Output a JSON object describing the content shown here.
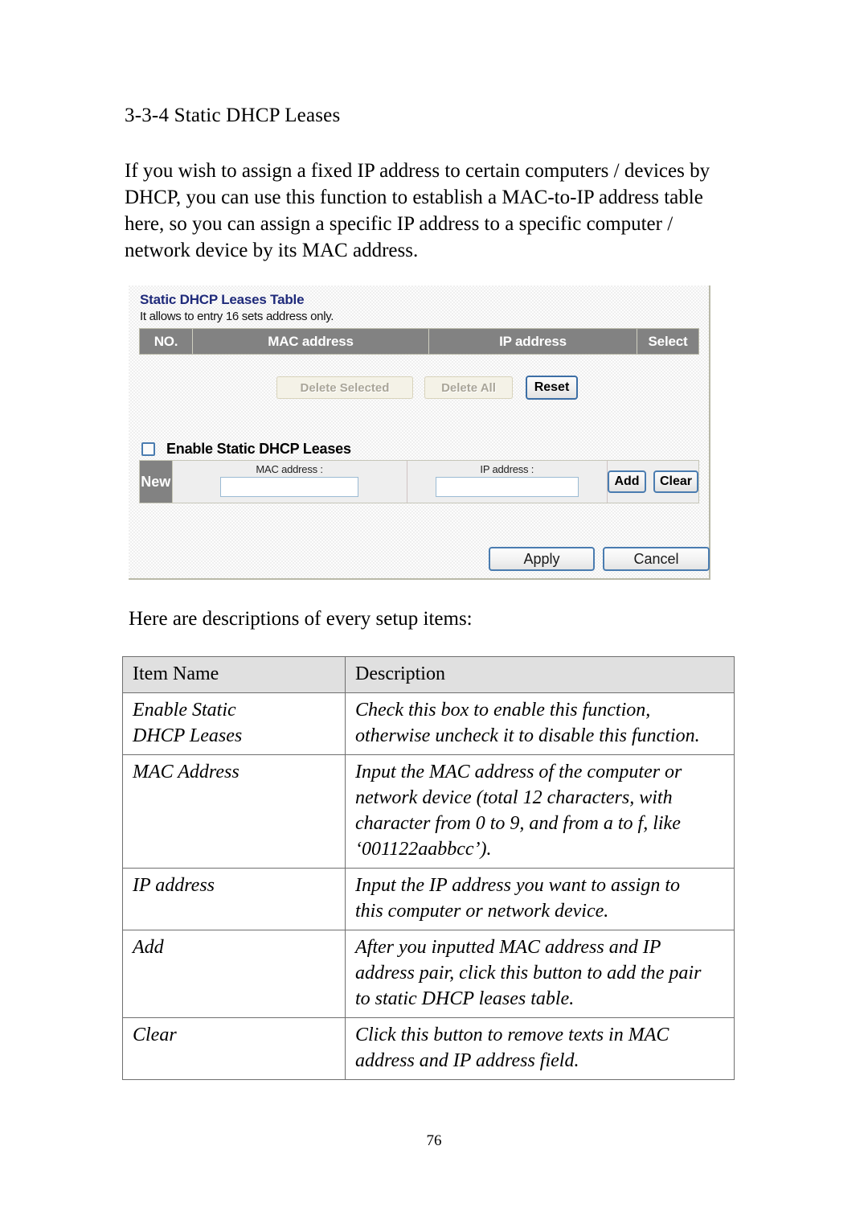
{
  "document": {
    "heading": "3-3-4 Static DHCP Leases",
    "intro_paragraph": "If you wish to assign a fixed IP address to certain computers / devices by DHCP, you can use this function to establish a MAC-to-IP address table here, so you can assign a specific IP address to a specific computer / network device by its MAC address.",
    "mid_paragraph": "Here are descriptions of every setup items:",
    "page_number": "76"
  },
  "screenshot": {
    "title": "Static DHCP Leases Table",
    "subtitle": "It allows to entry 16 sets address only.",
    "table_headers": {
      "no": "NO.",
      "mac_address": "MAC address",
      "ip_address": "IP address",
      "select": "Select"
    },
    "buttons": {
      "delete_selected": "Delete Selected",
      "delete_all": "Delete All",
      "reset": "Reset",
      "add": "Add",
      "clear": "Clear",
      "apply": "Apply",
      "cancel": "Cancel"
    },
    "enable_checkbox": {
      "label": "Enable Static DHCP Leases",
      "checked": false
    },
    "new_entry": {
      "tag": "New",
      "mac_label": "MAC address :",
      "mac_value": "",
      "ip_label": "IP address :",
      "ip_value": ""
    },
    "colors": {
      "title_blue": "#1f2a7a",
      "header_gray": "#828282",
      "panel_bg": "#efefef",
      "button_border_blue": "#4a7cb0",
      "disabled_bg": "#f4f2e7"
    }
  },
  "description_table": {
    "headers": {
      "item_name": "Item Name",
      "description": "Description"
    },
    "rows": [
      {
        "item_lines": [
          "Enable Static",
          "DHCP Leases"
        ],
        "desc_lines": [
          "Check this box to enable this function,",
          "otherwise uncheck it to disable this function."
        ]
      },
      {
        "item_lines": [
          "MAC Address"
        ],
        "desc_lines": [
          "Input the MAC address of the computer or",
          "network device (total 12 characters, with",
          "character from 0 to 9, and from a to f, like",
          "‘001122aabbcc’)."
        ]
      },
      {
        "item_lines": [
          "IP address"
        ],
        "desc_lines": [
          "Input the IP address you want to assign to",
          "this computer or network device."
        ]
      },
      {
        "item_lines": [
          "Add"
        ],
        "desc_lines": [
          "After you inputted MAC address and IP",
          "address pair, click this button to add the pair",
          "to static DHCP leases table."
        ]
      },
      {
        "item_lines": [
          "Clear"
        ],
        "desc_lines": [
          "Click this button to remove texts in MAC",
          "address and IP address field."
        ]
      }
    ]
  }
}
